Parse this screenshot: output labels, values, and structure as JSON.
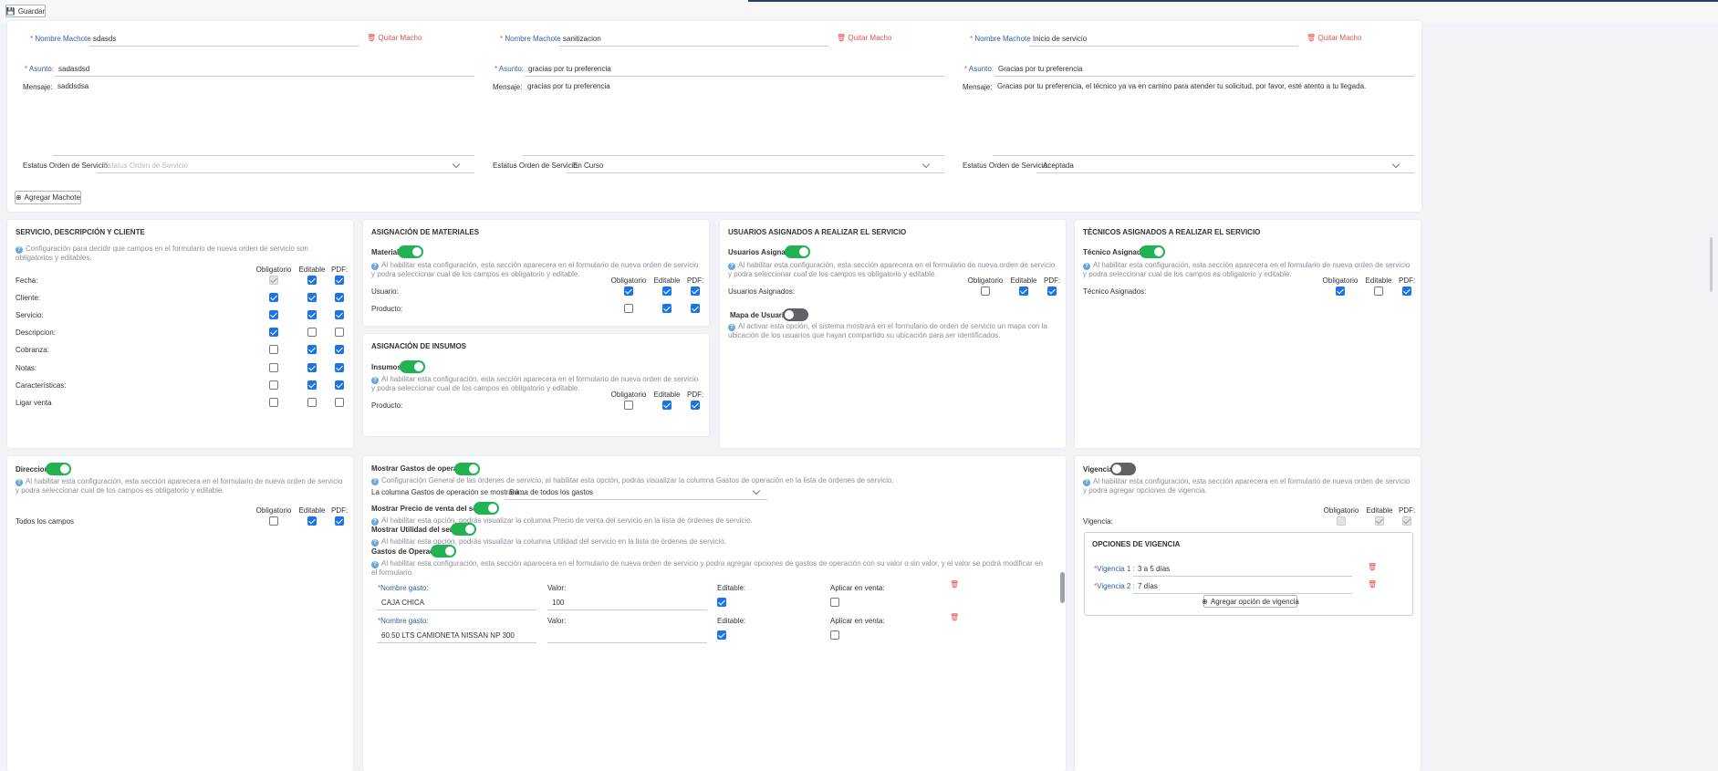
{
  "toolbar": {
    "save_icon": "save-icon",
    "save_label": "Guardar"
  },
  "templates": [
    {
      "name_label": "Nombre Machote :",
      "name_value": "sdasds",
      "remove_label": "Quitar Macho",
      "subject_label": "Asunto:",
      "subject_value": "sadasdsd",
      "message_label": "Mensaje:",
      "message_value": "saddsdsa",
      "status_label": "Estatus Orden de Servicio:",
      "status_value": "Estatus Orden de Servicio",
      "status_placeholder": true
    },
    {
      "name_label": "Nombre Machote :",
      "name_value": "sanitizacion",
      "remove_label": "Quitar Macho",
      "subject_label": "Asunto:",
      "subject_value": "gracias por tu preferencia",
      "message_label": "Mensaje:",
      "message_value": "gracias por tu preferencia",
      "status_label": "Estatus Orden de Servicio:",
      "status_value": "En Curso",
      "status_placeholder": false
    },
    {
      "name_label": "Nombre Machote :",
      "name_value": "Inicio de servicio",
      "remove_label": "Quitar Macho",
      "subject_label": "Asunto:",
      "subject_value": "Gracias por tu preferencia",
      "message_label": "Mensaje:",
      "message_value": "Gracias por tu preferencia, el técnico ya va en camino para atender tu solicitud, por favor, esté atento a tu llegada.",
      "status_label": "Estatus Orden de Servicio:",
      "status_value": "Aceptada",
      "status_placeholder": false
    }
  ],
  "add_template_label": "Agregar Machote",
  "cols": {
    "required": "Obligatorio",
    "editable": "Editable",
    "pdf": "PDF:"
  },
  "service": {
    "title": "SERVICIO, DESCRIPCIÓN Y CLIENTE",
    "hint": "Configuración para decidir que campos en el formulario de nueva orden de servicio son obligatorios y editables.",
    "rows": [
      {
        "label": "Fecha:",
        "req": true,
        "edit": true,
        "pdf": true,
        "req_disabled": true
      },
      {
        "label": "Cliente:",
        "req": true,
        "edit": true,
        "pdf": true
      },
      {
        "label": "Servicio:",
        "req": true,
        "edit": true,
        "pdf": true
      },
      {
        "label": "Descripcion:",
        "req": true,
        "edit": false,
        "pdf": false
      },
      {
        "label": "Cobranza:",
        "req": false,
        "edit": true,
        "pdf": true
      },
      {
        "label": "Notas:",
        "req": false,
        "edit": true,
        "pdf": true
      },
      {
        "label": "Características:",
        "req": false,
        "edit": true,
        "pdf": true
      },
      {
        "label": "Ligar venta",
        "req": false,
        "edit": false,
        "pdf": false
      }
    ]
  },
  "materials": {
    "title": "ASIGNACIÓN DE MATERIALES",
    "toggle_label": "Material",
    "toggle_on": true,
    "hint": "Al habilitar esta configuración, esta sección aparecera en el formulario de nueva orden de servicio y podra seleccionar cual de los campos es obligatorio y editable.",
    "rows": [
      {
        "label": "Usuario:",
        "req": true,
        "edit": true,
        "pdf": true
      },
      {
        "label": "Producto:",
        "req": false,
        "edit": true,
        "pdf": true
      }
    ]
  },
  "supplies": {
    "title": "ASIGNACIÓN DE INSUMOS",
    "toggle_label": "Insumos",
    "toggle_on": true,
    "hint": "Al habilitar esta configuración, esta sección aparecera en el formulario de nueva orden de servicio y podra seleccionar cual de los campos es obligatorio y editable.",
    "rows": [
      {
        "label": "Producto:",
        "req": false,
        "edit": true,
        "pdf": true
      }
    ]
  },
  "users": {
    "title": "USUARIOS ASIGNADOS A REALIZAR EL SERVICIO",
    "toggle_label": "Usuarios Asignados",
    "toggle_on": true,
    "hint": "Al habilitar esta configuración, esta sección aparecera en el formulario de nueva orden de servicio y podra seleccionar cual de los campos es obligatorio y editable.",
    "rows": [
      {
        "label": "Usuarios Asignados:",
        "req": false,
        "edit": true,
        "pdf": true
      }
    ],
    "map_label": "Mapa de Usuarios",
    "map_on": false,
    "map_hint": "Al activar esta opción, el sistema mostrará en el formulario de orden de servicio un mapa con la ubicación de los usuarios que hayan compartido su ubicación para ser identificados."
  },
  "techs": {
    "title": "TÉCNICOS ASIGNADOS A REALIZAR EL SERVICIO",
    "toggle_label": "Técnico Asignados",
    "toggle_on": true,
    "hint": "Al habilitar esta configuración, esta sección aparecera en el formulario de nueva orden de servicio y podra seleccionar cual de los campos es obligatorio y editable.",
    "rows": [
      {
        "label": "Técnico Asignados:",
        "req": true,
        "edit": false,
        "pdf": true
      }
    ]
  },
  "address": {
    "toggle_label": "Direccion",
    "toggle_on": true,
    "hint": "Al habilitar esta configuración, esta sección aparecera en el formulario de nueva orden de servicio y podra seleccionar cual de los campos es obligatorio y editable.",
    "rows": [
      {
        "label": "Todos los campos",
        "req": false,
        "edit": true,
        "pdf": true
      }
    ]
  },
  "costs": {
    "show_label": "Mostrar Gastos de operación",
    "show_on": true,
    "show_hint": "Configuración General de las órdenes de servicio, al habilitar esta opción, podrás visualizar la columna Gastos de operación en la lista de órdenes de servicio.",
    "column_label": "La columna Gastos de operación se mostrará...",
    "column_value": "Suma de todos los gastos",
    "price_label": "Mostrar Precio de venta del servicio",
    "price_on": true,
    "price_hint": "Al habilitar esta opción, podrás visualizar la columna Precio de venta del servicio en la lista de órdenes de servicio.",
    "util_label": "Mostrar Utilidad del servicio",
    "util_on": true,
    "util_hint": "Al habilitar esta opción, podrás visualizar la columna Utilidad del servicio en la lista de órdenes de servicio.",
    "ops_label": "Gastos de Operación",
    "ops_on": true,
    "ops_hint": "Al habilitar esta configuración, esta sección aparecera en el formulario de nueva orden de servicio y podra agregar opciones de gastos de operación con su valor o sin valor, y el valor se podrá modificar en el formulario.",
    "name_label": "Nombre gasto:",
    "value_label": "Valor:",
    "editable_label": "Editable:",
    "apply_label": "Aplicar en venta:",
    "items": [
      {
        "name": "CAJA CHICA",
        "value": "100",
        "editable": true,
        "apply": false
      },
      {
        "name": "60.50 LTS CAMIONETA NISSAN NP 300",
        "value": "",
        "editable": true,
        "apply": false
      }
    ]
  },
  "validity": {
    "toggle_label": "Vigencia",
    "toggle_on": false,
    "hint": "Al habilitar esta configuración, esta sección aparecera en el formulario de nueva orden de servicio y podra agregar opciones de vigencia.",
    "row_label": "Vigencia:",
    "options_title": "OPCIONES DE VIGENCIA",
    "options": [
      {
        "label": "Vigencia 1 :",
        "value": "3 a 5 días"
      },
      {
        "label": "Vigencia 2 :",
        "value": "7 días"
      }
    ],
    "add_label": "Agregar opción de vigencia"
  }
}
